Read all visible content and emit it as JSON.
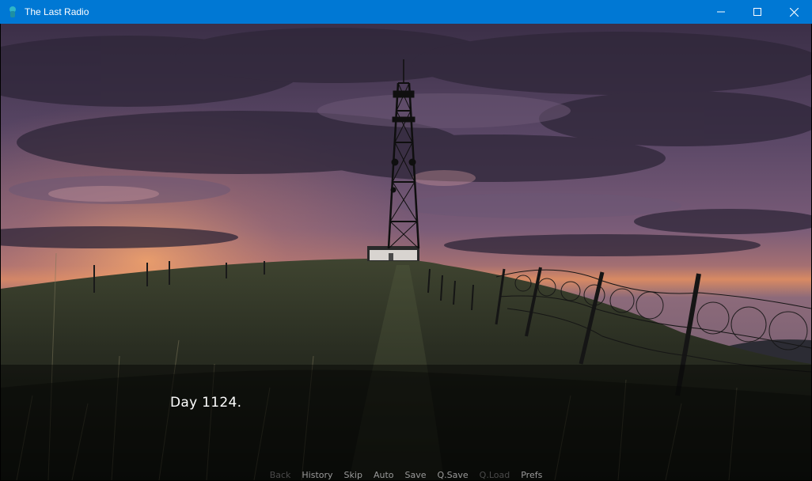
{
  "window": {
    "title": "The Last Radio",
    "icon": "app-logo-icon",
    "controls": [
      "minimize-icon",
      "maximize-icon",
      "close-icon"
    ]
  },
  "dialogue": {
    "text": "Day 1124."
  },
  "quick_menu": {
    "items": [
      {
        "label": "Back",
        "enabled": false
      },
      {
        "label": "History",
        "enabled": true
      },
      {
        "label": "Skip",
        "enabled": true
      },
      {
        "label": "Auto",
        "enabled": true
      },
      {
        "label": "Save",
        "enabled": true
      },
      {
        "label": "Q.Save",
        "enabled": true
      },
      {
        "label": "Q.Load",
        "enabled": false
      },
      {
        "label": "Prefs",
        "enabled": true
      }
    ]
  },
  "colors": {
    "titlebar": "#0078d4",
    "quick_menu_enabled": "#9a9a9a",
    "quick_menu_disabled": "#4a4a4a"
  }
}
